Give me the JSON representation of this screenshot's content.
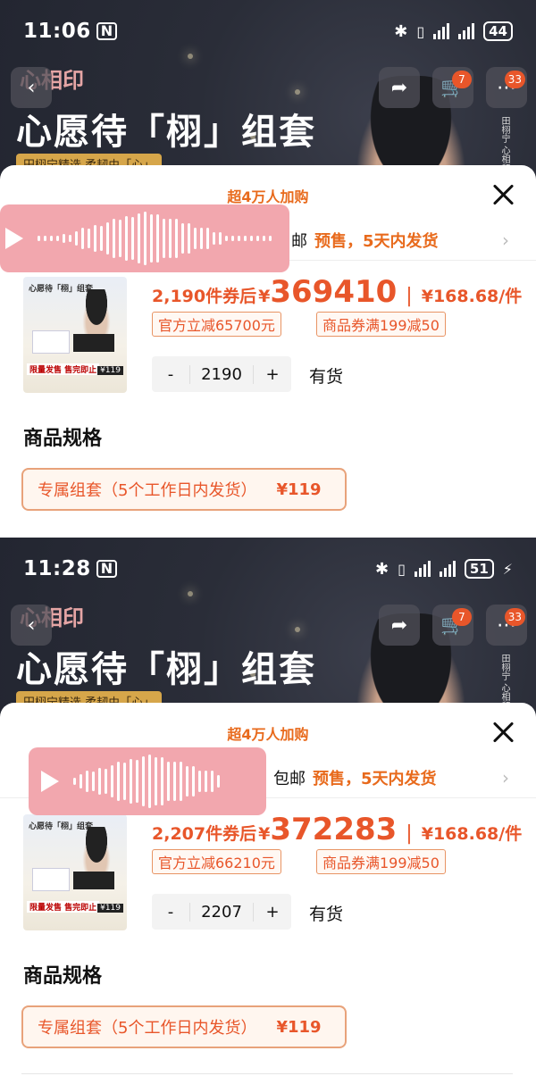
{
  "screens": [
    {
      "status": {
        "time": "11:06",
        "nfc": "N",
        "battery": "44"
      },
      "banner": {
        "logo": "心相印",
        "title": "心愿待「栩」组套",
        "subtitle": "田栩宁精选 柔韧由「心」",
        "vertical_text": "田栩宁 心相印心选",
        "cart_badge": "7",
        "msg_badge": "33"
      },
      "sheet": {
        "buy_count": "超4万人加购",
        "shipping": {
          "free": "邮",
          "presale": "预售，5天内发货"
        },
        "product_image": {
          "title": "心愿待「栩」组套",
          "promo": "限量发售 售完即止",
          "price_tag": "¥119"
        },
        "price": {
          "count": "2,190件券后",
          "yen": "¥",
          "total": "369410",
          "unit_price": "¥168.68/件"
        },
        "tags": [
          "官方立减65700元",
          "商品券满199减50"
        ],
        "quantity": {
          "minus": "-",
          "value": "2190",
          "plus": "+"
        },
        "stock": "有货",
        "spec_title": "商品规格",
        "spec_option": {
          "label": "专属组套（5个工作日内发货）",
          "price": "¥119"
        }
      }
    },
    {
      "status": {
        "time": "11:28",
        "nfc": "N",
        "battery": "51"
      },
      "banner": {
        "logo": "心相印",
        "title": "心愿待「栩」组套",
        "subtitle": "田栩宁精选 柔韧由「心」",
        "vertical_text": "田栩宁 心相印心选",
        "cart_badge": "7",
        "msg_badge": "33"
      },
      "sheet": {
        "buy_count": "超4万人加购",
        "shipping": {
          "free": "包邮",
          "presale": "预售，5天内发货"
        },
        "product_image": {
          "title": "心愿待「栩」组套",
          "promo": "限量发售 售完即止",
          "price_tag": "¥119"
        },
        "price": {
          "count": "2,207件券后",
          "yen": "¥",
          "total": "372283",
          "unit_price": "¥168.68/件"
        },
        "tags": [
          "官方立减66210元",
          "商品券满199减50"
        ],
        "quantity": {
          "minus": "-",
          "value": "2207",
          "plus": "+"
        },
        "stock": "有货",
        "spec_title": "商品规格",
        "spec_option": {
          "label": "专属组套（5个工作日内发货）",
          "price": "¥119"
        }
      }
    }
  ],
  "icons": {
    "back": "back-arrow-icon",
    "share": "share-icon",
    "cart": "cart-icon",
    "message": "message-icon",
    "close": "close-icon",
    "play": "play-icon",
    "chevron": "chevron-right-icon"
  }
}
